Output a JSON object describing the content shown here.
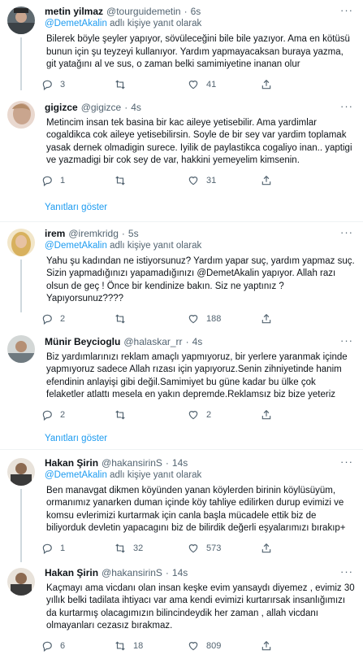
{
  "reply_prefix": "adlı kişiye yanıt olarak",
  "tweets": [
    {
      "name": "metin yilmaz",
      "handle": "@tourguidemetin",
      "time": "6s",
      "reply_to": "@DemetAkalin",
      "text": "Bilerek böyle şeyler yapıyor, sövüleceğini bile bile yazıyor. Ama en kötüsü bunun için şu teyzeyi kullanıyor. Yardım yapmayacaksan buraya yazma, git yatağını al ve sus, o zaman belki samimiyetine inanan olur",
      "replies": "3",
      "retweets": "",
      "likes": "41"
    },
    {
      "name": "gigizce",
      "handle": "@gigizce",
      "time": "4s",
      "reply_to": "",
      "text": "Metincim insan tek basina bir kac aileye yetisebilir. Ama yardimlar cogaldikca cok aileye yetisebilirsin. Soyle de bir sey var yardim toplamak yasak dernek olmadigin surece. Iyilik de paylastikca cogaliyo inan.. yaptigi ve yazmadigi bir cok sey de var, hakkini yemeyelim kimsenin.",
      "replies": "1",
      "retweets": "",
      "likes": "31"
    },
    {
      "name": "irem",
      "handle": "@iremkridg",
      "time": "5s",
      "reply_to": "@DemetAkalin",
      "text": "Yahu şu kadından ne istiyorsunuz? Yardım yapar suç, yardım yapmaz suç. Sizin yapmadığınızı yapamadığınızı  @DemetAkalin yapıyor. Allah razı olsun de geç ! Önce bir kendinize bakın. Siz ne yaptınız ? Yapıyorsunuz????",
      "replies": "2",
      "retweets": "",
      "likes": "188"
    },
    {
      "name": "Münir Beycioglu",
      "handle": "@halaskar_rr",
      "time": "4s",
      "reply_to": "",
      "text": "Biz yardımlarınızı reklam amaçlı yapmıyoruz, bir yerlere yaranmak içinde yapmıyoruz sadece Allah rızası için yapıyoruz.Senin zihniyetinde hanim efendinin anlayişi gibi değil.Samimiyet bu güne kadar bu ülke çok felaketler atlattı mesela en yakın depremde.Reklamsız biz bize yeteriz",
      "replies": "2",
      "retweets": "",
      "likes": "2"
    },
    {
      "name": "Hakan Şirin",
      "handle": "@hakansirinS",
      "time": "14s",
      "reply_to": "@DemetAkalin",
      "text": "Ben manavgat dikmen köyünden yanan köylerden birinin köylüsüyüm, ormanımız yanarken duman içinde köy tahliye edilirken durup evimizi ve komsu evlerimizi kurtarmak için canla başla mücadele ettik biz de biliyorduk devletin yapacagını biz de bilirdik değerli eşyalarımızı bırakıp+",
      "replies": "1",
      "retweets": "32",
      "likes": "573"
    },
    {
      "name": "Hakan Şirin",
      "handle": "@hakansirinS",
      "time": "14s",
      "reply_to": "",
      "text": "Kaçmayı ama vicdanı olan insan keşke evim yansaydı diyemez , evimiz 30 yıllık belki tadilata ihtiyacı var ama kendi evimizi kurtarırsak insanlığımızı da kurtarmış olacagımızın bilincindeydik her zaman , allah vicdanı olmayanları cezasız bırakmaz.",
      "replies": "6",
      "retweets": "18",
      "likes": "809"
    }
  ],
  "show_replies_label": "Yanıtları göster",
  "avatars": [
    "#6b6f73",
    "#c9a58e",
    "#e2c07a",
    "#9aa0a2",
    "#7a5c44",
    "#7a5c44"
  ],
  "accent": "#1d9bf0"
}
